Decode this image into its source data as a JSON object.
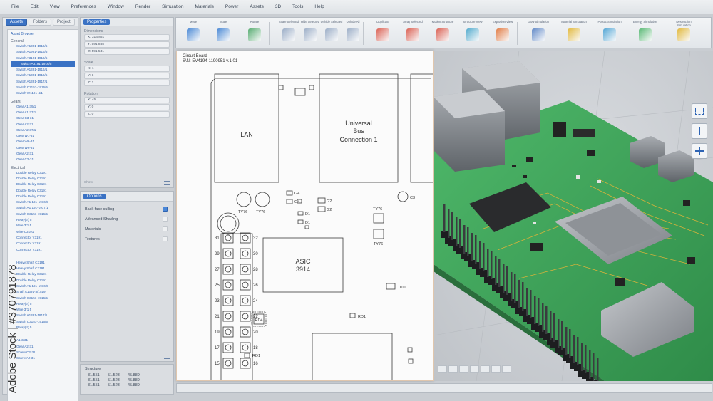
{
  "menu": [
    "File",
    "Edit",
    "View",
    "Preferences",
    "Window",
    "Render",
    "Simulation",
    "Materials",
    "Power",
    "Assets",
    "3D",
    "Tools",
    "Help"
  ],
  "left_tabs": [
    "Assets",
    "Folders",
    "Project"
  ],
  "asset_browser": {
    "title": "Asset Browser",
    "groups": [
      {
        "name": "General",
        "items": [
          "Switch A1391-1916/5",
          "Switch A1991-1916/5",
          "Switch A3191-1916/5",
          "Switch A3191-1916/5",
          "Switch A1391-1916/1",
          "Switch A1391-1916/5",
          "Switch A1391-1917/1",
          "Switch C3151-1916/5",
          "Switch W1191-4/1"
        ],
        "highlight": 3
      },
      {
        "name": "Gears",
        "items": [
          "Gear A1-39/1",
          "Gear A1-37/1",
          "Gear C3-31",
          "Gear A2-31",
          "Gear A2-37/1",
          "Gear W1-31",
          "Gear W6-31",
          "Gear W6-31",
          "Gear A2-31",
          "Gear C2-31"
        ]
      },
      {
        "name": "Electrical",
        "items": [
          "Double Relay C3191",
          "Double Relay C3191",
          "Double Relay C3191",
          "Double Relay C3191",
          "Double Relay C3191",
          "Switch A1 191-1916/5",
          "Switch A1 191-1917/1",
          "Switch C3151-1916/5",
          "Relay(tr) 5",
          "Wire 3r1 5",
          "Wire C3191",
          "Connector Y3191",
          "Connector Y3191",
          "Connector Y3191"
        ]
      },
      {
        "name": "",
        "items": [
          "Heavy Shaft C3191",
          "Heavy Shaft C3191",
          "Double Relay C3191",
          "Double Relay C3191",
          "Switch A1 191-1916/5",
          "Shaft A1391-3/1519",
          "Switch C3151-1916/5",
          "Relay(tr) 5",
          "Wire 3r1 5",
          "Switch A1391-1917/1",
          "Switch C3151-1916/5",
          "Relay(tr) 5"
        ]
      },
      {
        "name": "",
        "items": [
          "A1-3/31",
          "Gear A2-31",
          "Screw C2-31",
          "Screw A2-31"
        ]
      }
    ]
  },
  "properties": {
    "header": "Properties",
    "dimensions_label": "Dimensions",
    "dimensions": [
      "X: 314.851",
      "Y: 591.885",
      "Z: 591.531"
    ],
    "scale_label": "Scale",
    "scale": [
      "X: 1",
      "Y: 1",
      "Z: 1"
    ],
    "rotation_label": "Rotation",
    "rotation": [
      "X: 45",
      "Y: 0",
      "Z: 0"
    ],
    "show_label": "Show"
  },
  "options": {
    "header": "Options",
    "rows": [
      {
        "label": "Back face culling",
        "checked": true
      },
      {
        "label": "Advanced Shading",
        "checked": false
      },
      {
        "label": "Materials",
        "checked": false
      },
      {
        "label": "Textures",
        "checked": false
      }
    ]
  },
  "structure": {
    "title": "Structure",
    "rows": [
      [
        "31.551",
        "51.523",
        "45.889"
      ],
      [
        "31.551",
        "51.523",
        "45.889"
      ],
      [
        "31.551",
        "51.523",
        "45.889"
      ]
    ]
  },
  "toolbar": [
    {
      "label": "Move",
      "icon": "move-icon"
    },
    {
      "label": "Scale",
      "icon": "scale-icon"
    },
    {
      "label": "Rotate",
      "icon": "rotate-icon"
    },
    {
      "label": "Scale Selected",
      "icon": "scale-selected-icon"
    },
    {
      "label": "Hide Selected",
      "icon": "hide-selected-icon"
    },
    {
      "label": "Unhide Selected",
      "icon": "unhide-selected-icon"
    },
    {
      "label": "Unhide All",
      "icon": "unhide-all-icon"
    },
    {
      "label": "Duplicate",
      "icon": "duplicate-icon"
    },
    {
      "label": "Array Selected",
      "icon": "array-icon"
    },
    {
      "label": "Motion Structure",
      "icon": "motion-icon"
    },
    {
      "label": "Structure View",
      "icon": "structure-view-icon"
    },
    {
      "label": "Explosion View",
      "icon": "explosion-view-icon"
    },
    {
      "label": "Glow Simulation",
      "icon": "glow-icon"
    },
    {
      "label": "Material Simulation",
      "icon": "material-icon"
    },
    {
      "label": "Plastic Simulation",
      "icon": "plastic-icon"
    },
    {
      "label": "Energy Simulation",
      "icon": "energy-icon"
    },
    {
      "label": "Destruction Simulation",
      "icon": "destruction-icon"
    }
  ],
  "drawing": {
    "title": "Circuit Board",
    "serial": "S\\N: EV4194-1190951 v.1.01",
    "lan": "LAN",
    "usb": [
      "Universal",
      "Bus",
      "Connection 1"
    ],
    "asic": [
      "ASIC",
      "3914"
    ],
    "labels": {
      "g4a": "G4",
      "g4b": "G4",
      "g2a": "G2",
      "g2b": "G2",
      "d1a": "D1",
      "d1b": "D1",
      "ty76a": "TY76",
      "ty76b": "TY76",
      "ty76c": "TY76",
      "ty76d": "TY76",
      "c3": "C3",
      "t01": "T01",
      "rd1a": "RD1",
      "rd1b": "RD1",
      "rd4": "RD4"
    },
    "pin_left": [
      "31",
      "29",
      "27",
      "25",
      "23",
      "21",
      "19",
      "17",
      "15"
    ],
    "pin_right": [
      "32",
      "30",
      "28",
      "26",
      "24",
      "22",
      "20",
      "18",
      "16"
    ]
  },
  "watermark": "Adobe Stock | #370791878",
  "colors": {
    "accent": "#3a72c4",
    "pcb": "#3aa45a"
  }
}
